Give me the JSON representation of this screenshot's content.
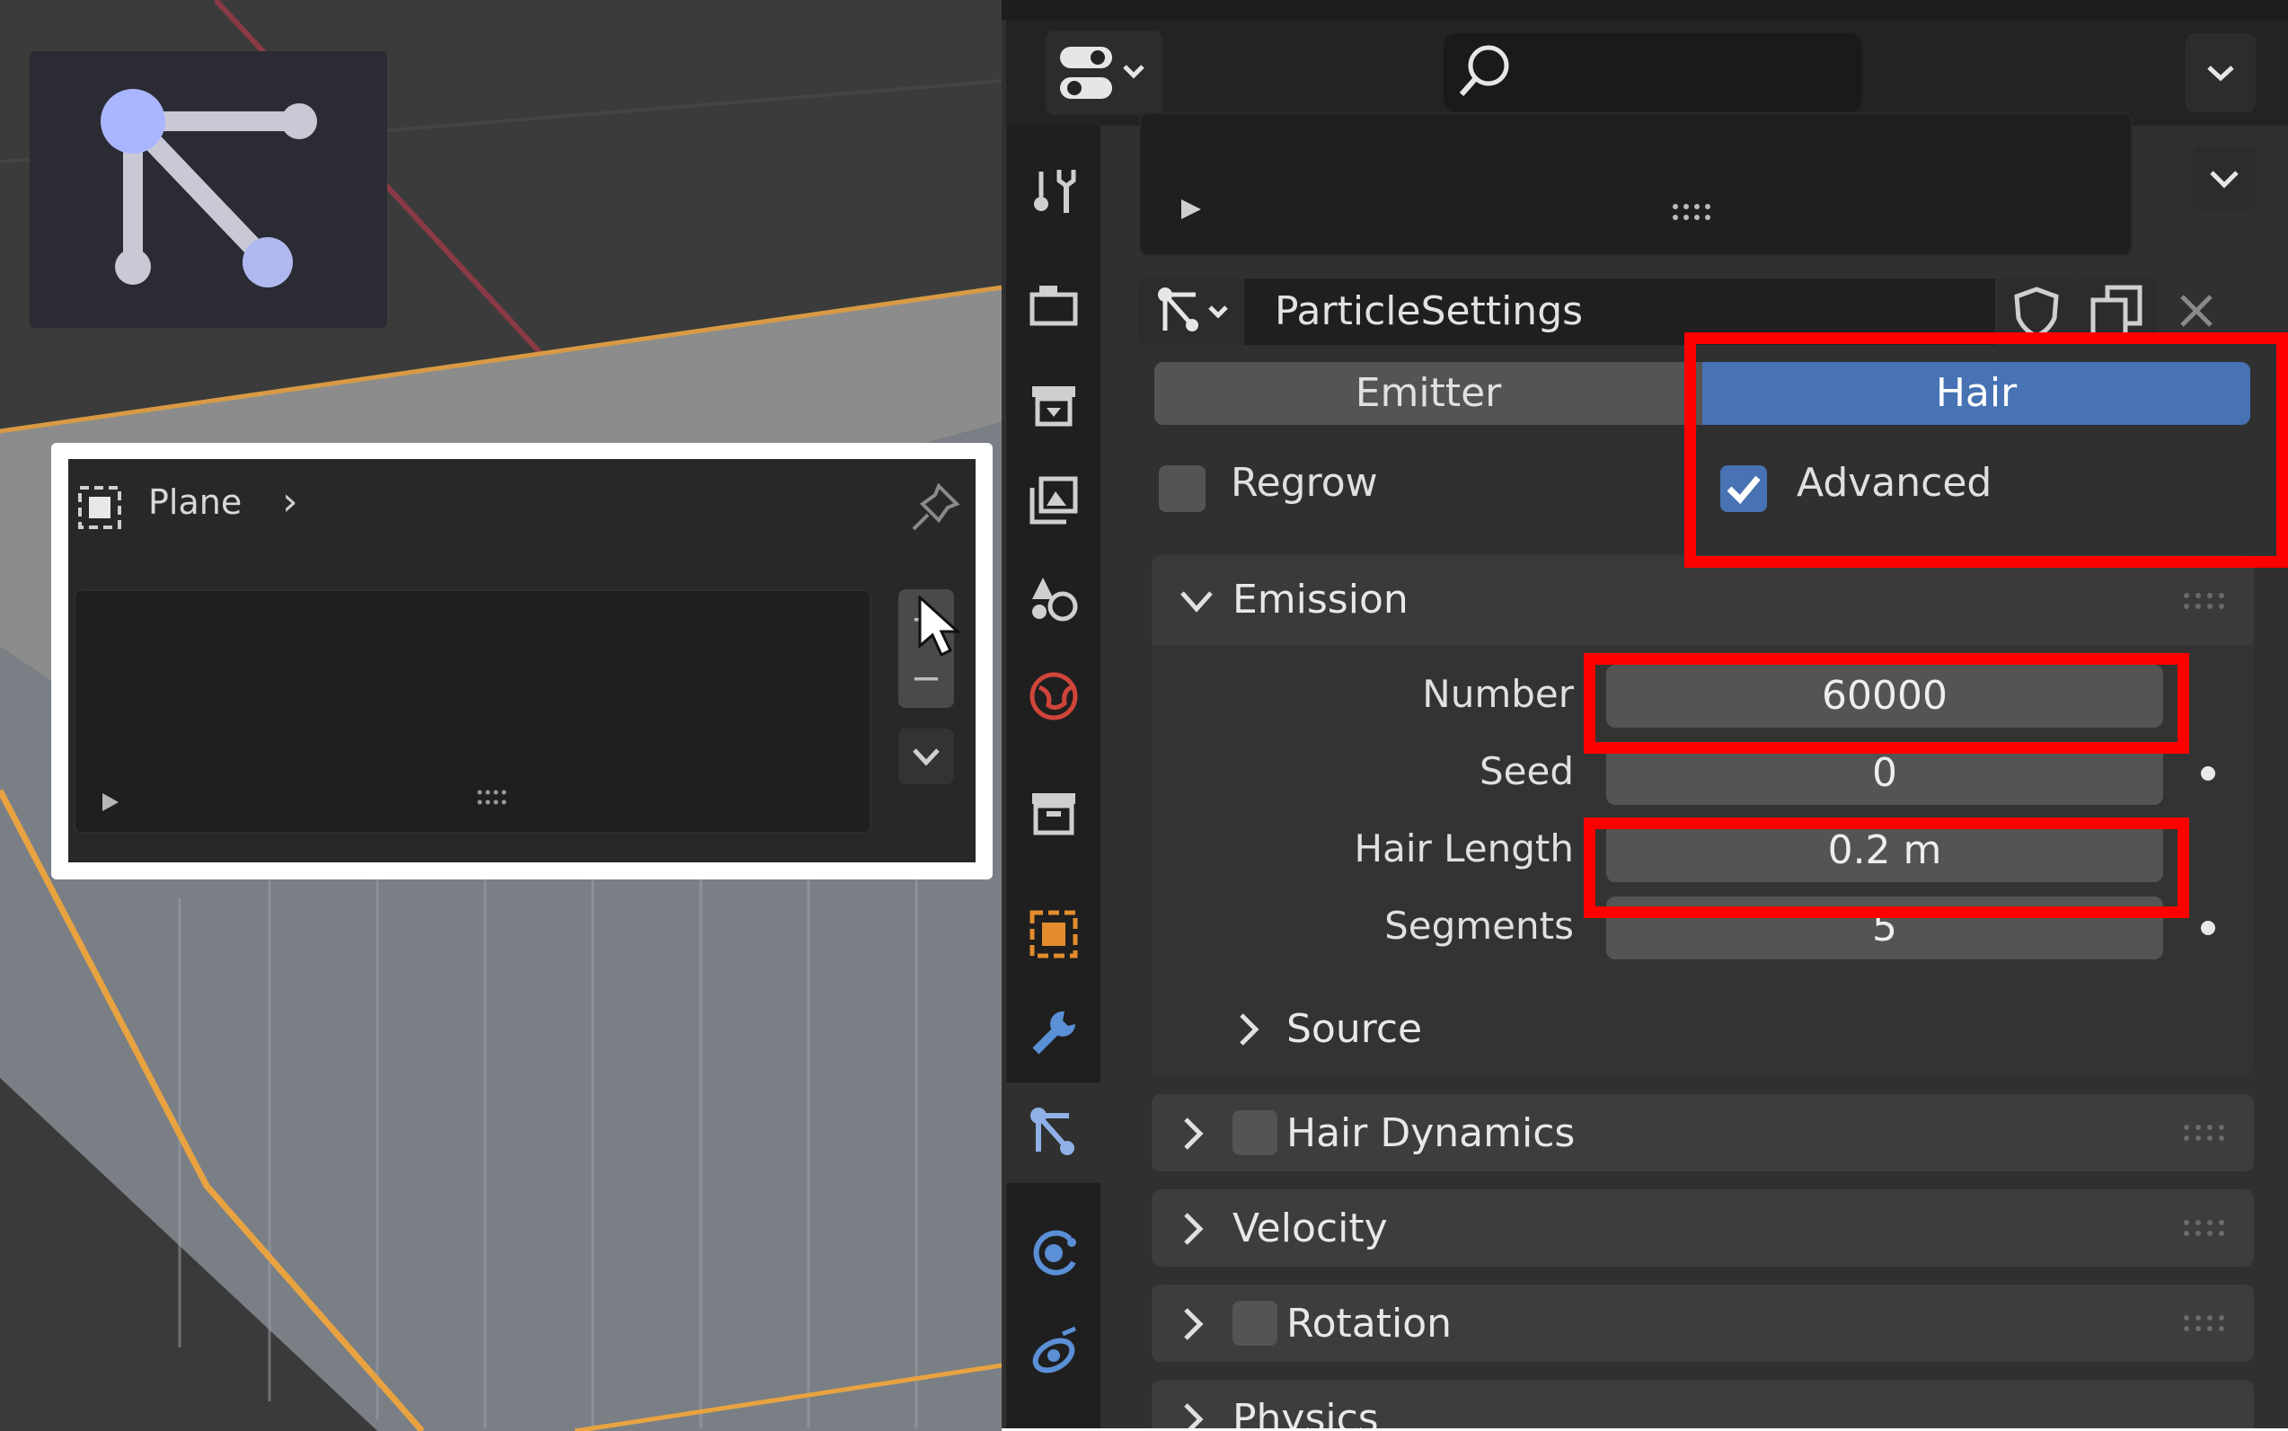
{
  "viewport": {
    "inset": {
      "object_name": "Plane",
      "add_label": "+",
      "remove_label": "−"
    }
  },
  "properties": {
    "particle_settings_name": "ParticleSettings",
    "type_options": [
      "Emitter",
      "Hair"
    ],
    "selected_type": "Hair",
    "regrow_label": "Regrow",
    "regrow_checked": false,
    "advanced_label": "Advanced",
    "advanced_checked": true,
    "emission": {
      "title": "Emission",
      "number_label": "Number",
      "number_value": "60000",
      "seed_label": "Seed",
      "seed_value": "0",
      "hair_length_label": "Hair Length",
      "hair_length_value": "0.2 m",
      "segments_label": "Segments",
      "segments_value": "5",
      "source_label": "Source"
    },
    "panels": {
      "hair_dynamics": "Hair Dynamics",
      "velocity": "Velocity",
      "rotation": "Rotation",
      "physics": "Physics"
    }
  },
  "colors": {
    "accent_blue": "#4772b3",
    "highlight_red": "#ff0000",
    "panel_bg": "#303030"
  }
}
